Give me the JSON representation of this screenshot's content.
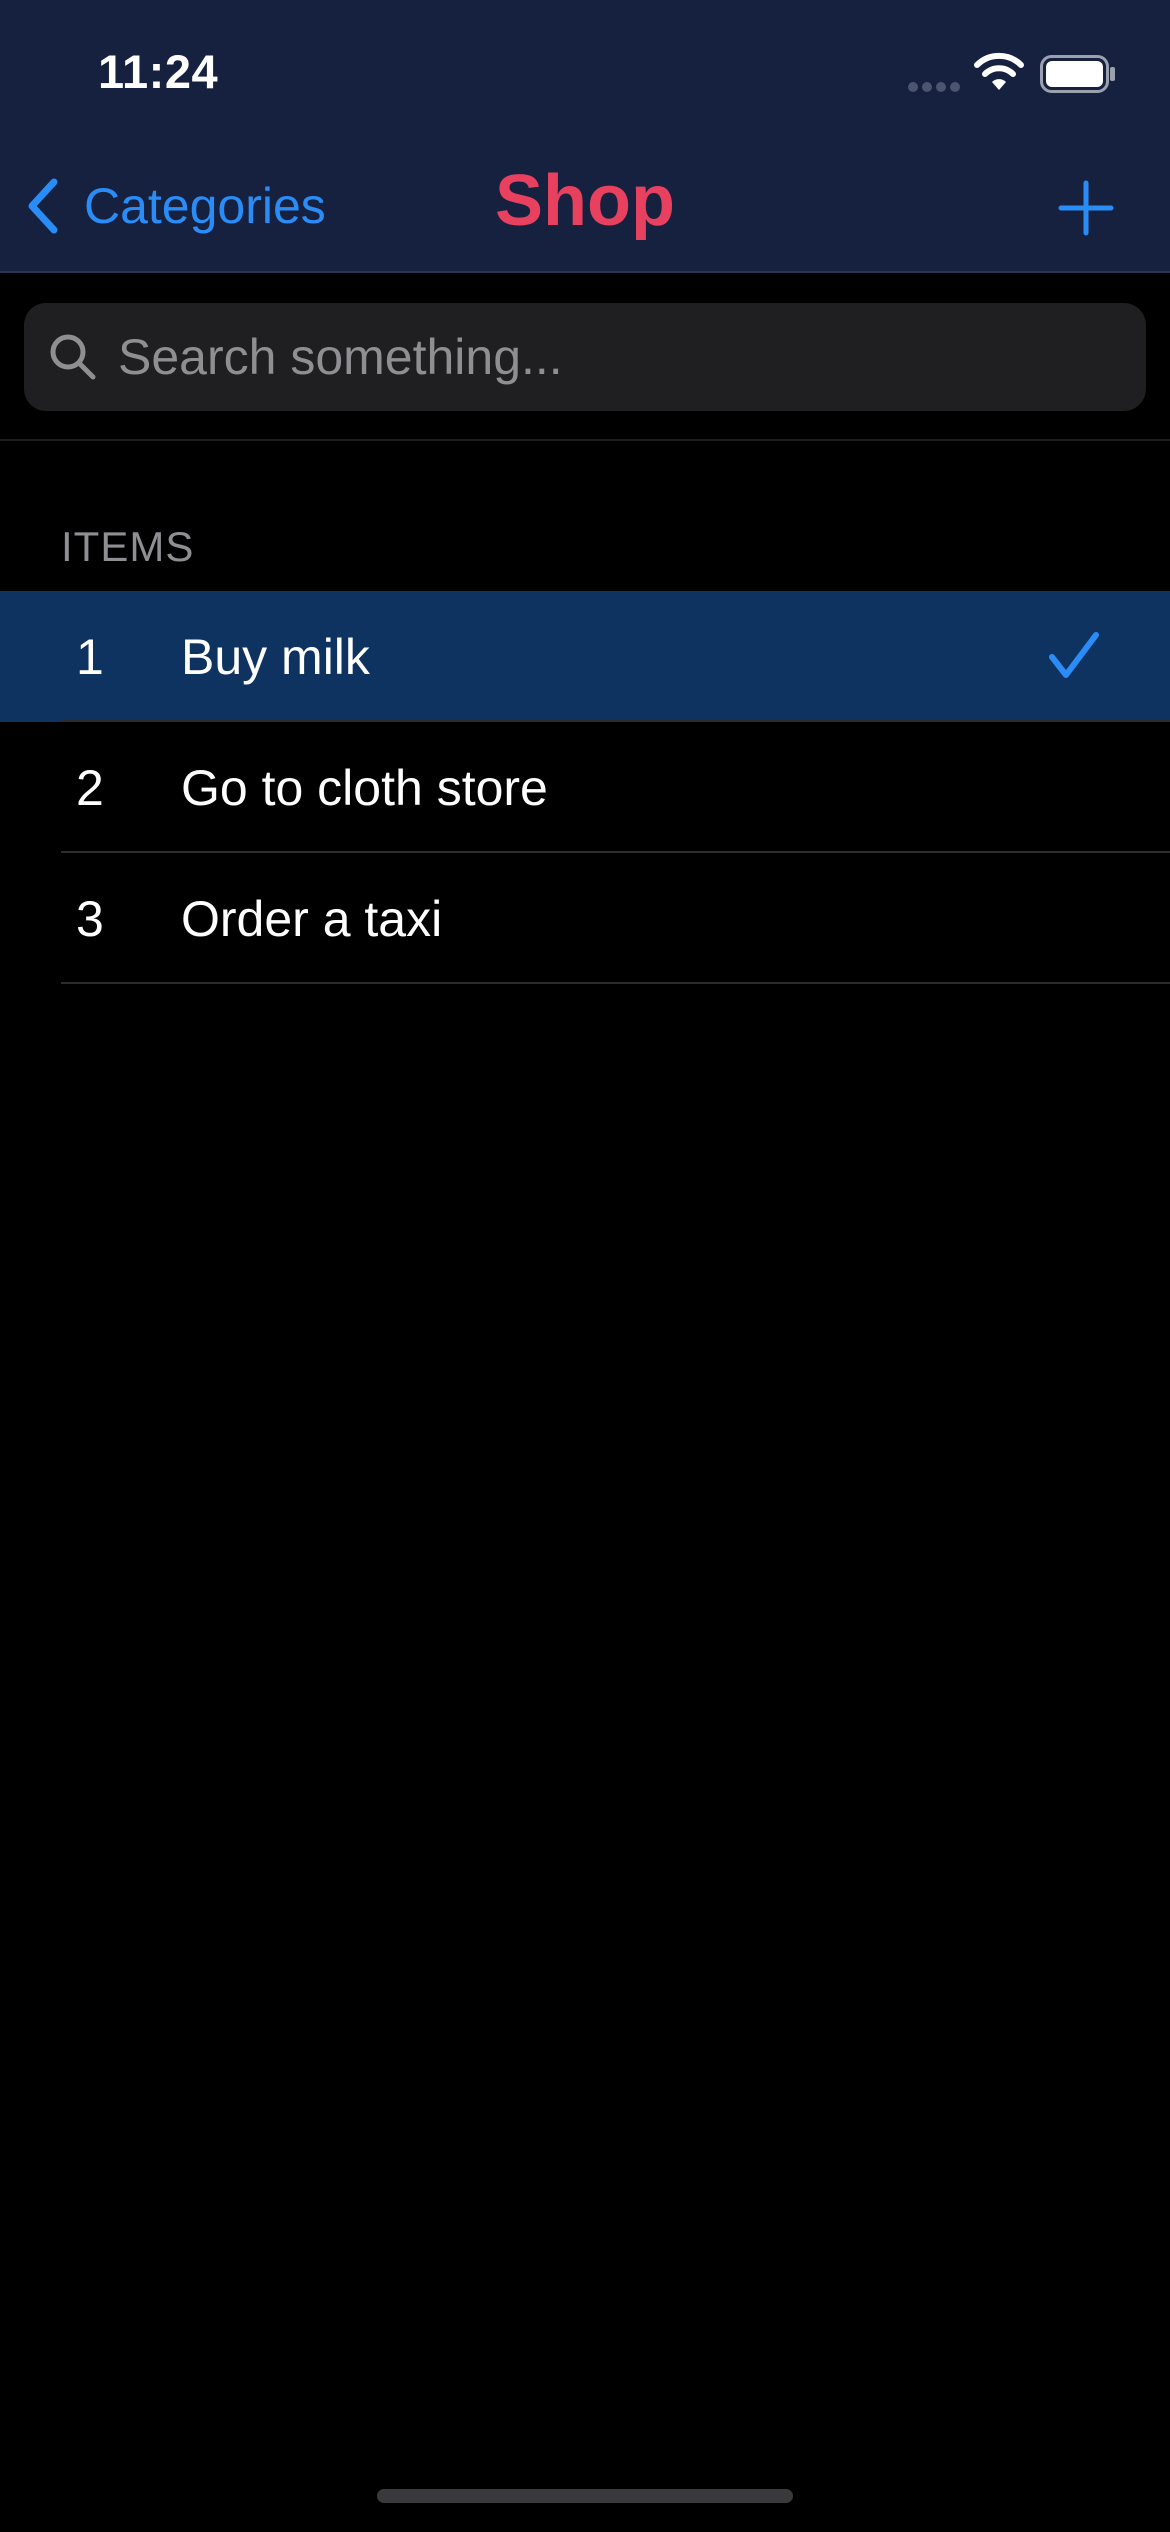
{
  "status_bar": {
    "time": "11:24"
  },
  "nav": {
    "back_label": "Categories",
    "title": "Shop"
  },
  "search": {
    "placeholder": "Search something...",
    "value": ""
  },
  "section": {
    "header": "ITEMS"
  },
  "items": [
    {
      "number": "1",
      "title": "Buy milk",
      "checked": true,
      "selected": true
    },
    {
      "number": "2",
      "title": "Go to cloth store",
      "checked": false,
      "selected": false
    },
    {
      "number": "3",
      "title": "Order a taxi",
      "checked": false,
      "selected": false
    }
  ],
  "colors": {
    "header_bg": "#16213f",
    "accent_blue": "#2a8cf7",
    "title_red": "#e8415f",
    "selected_row_bg": "#0f3360"
  },
  "icons": {
    "back": "chevron-left-icon",
    "add": "plus-icon",
    "search": "magnifying-glass-icon",
    "check": "checkmark-icon",
    "wifi": "wifi-icon",
    "battery": "battery-icon",
    "signal": "cellular-signal-icon"
  }
}
